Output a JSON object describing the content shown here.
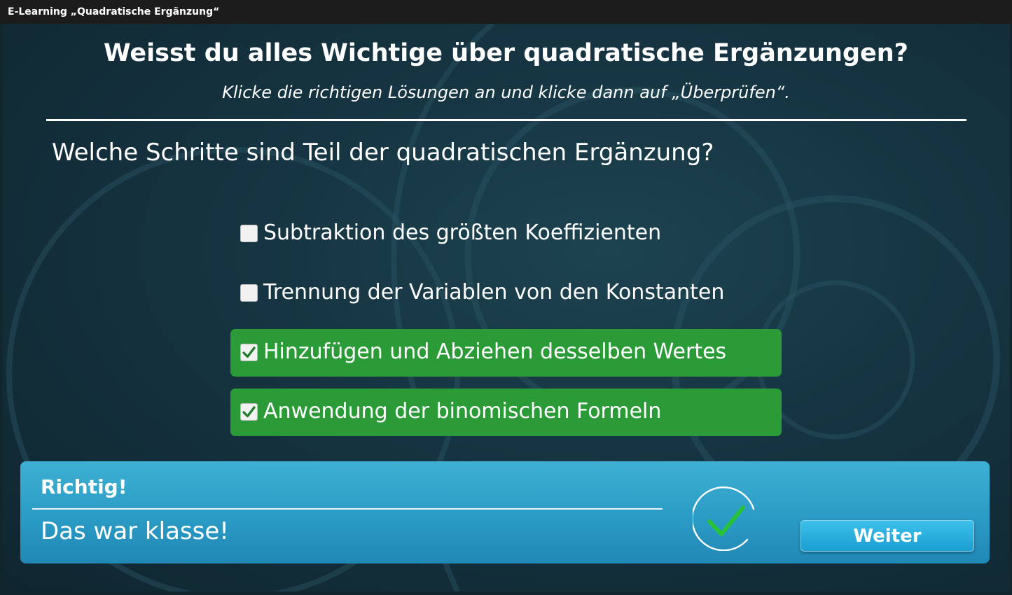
{
  "window": {
    "title": "E-Learning „Quadratische Ergänzung“"
  },
  "header": {
    "title": "Weisst du alles Wichtige über quadratische Ergänzungen?",
    "instruction": "Klicke die richtigen Lösungen an und klicke dann auf „Überprüfen“."
  },
  "question": {
    "text": "Welche Schritte sind Teil der quadratischen Ergänzung?",
    "options": [
      {
        "label": "Subtraktion des größten Koeffizienten",
        "checked": false
      },
      {
        "label": "Trennung der Variablen von den Konstanten",
        "checked": false
      },
      {
        "label": "Hinzufügen und Abziehen desselben Wertes",
        "checked": true
      },
      {
        "label": "Anwendung der binomischen Formeln",
        "checked": true
      }
    ]
  },
  "feedback": {
    "title": "Richtig!",
    "message": "Das war klasse!",
    "icon": "checkmark-circle-icon",
    "next_label": "Weiter"
  },
  "colors": {
    "background": "#153340",
    "selected_option": "#2b9b38",
    "feedback_panel": "#2a9cc5",
    "checkmark": "#27c23a"
  }
}
